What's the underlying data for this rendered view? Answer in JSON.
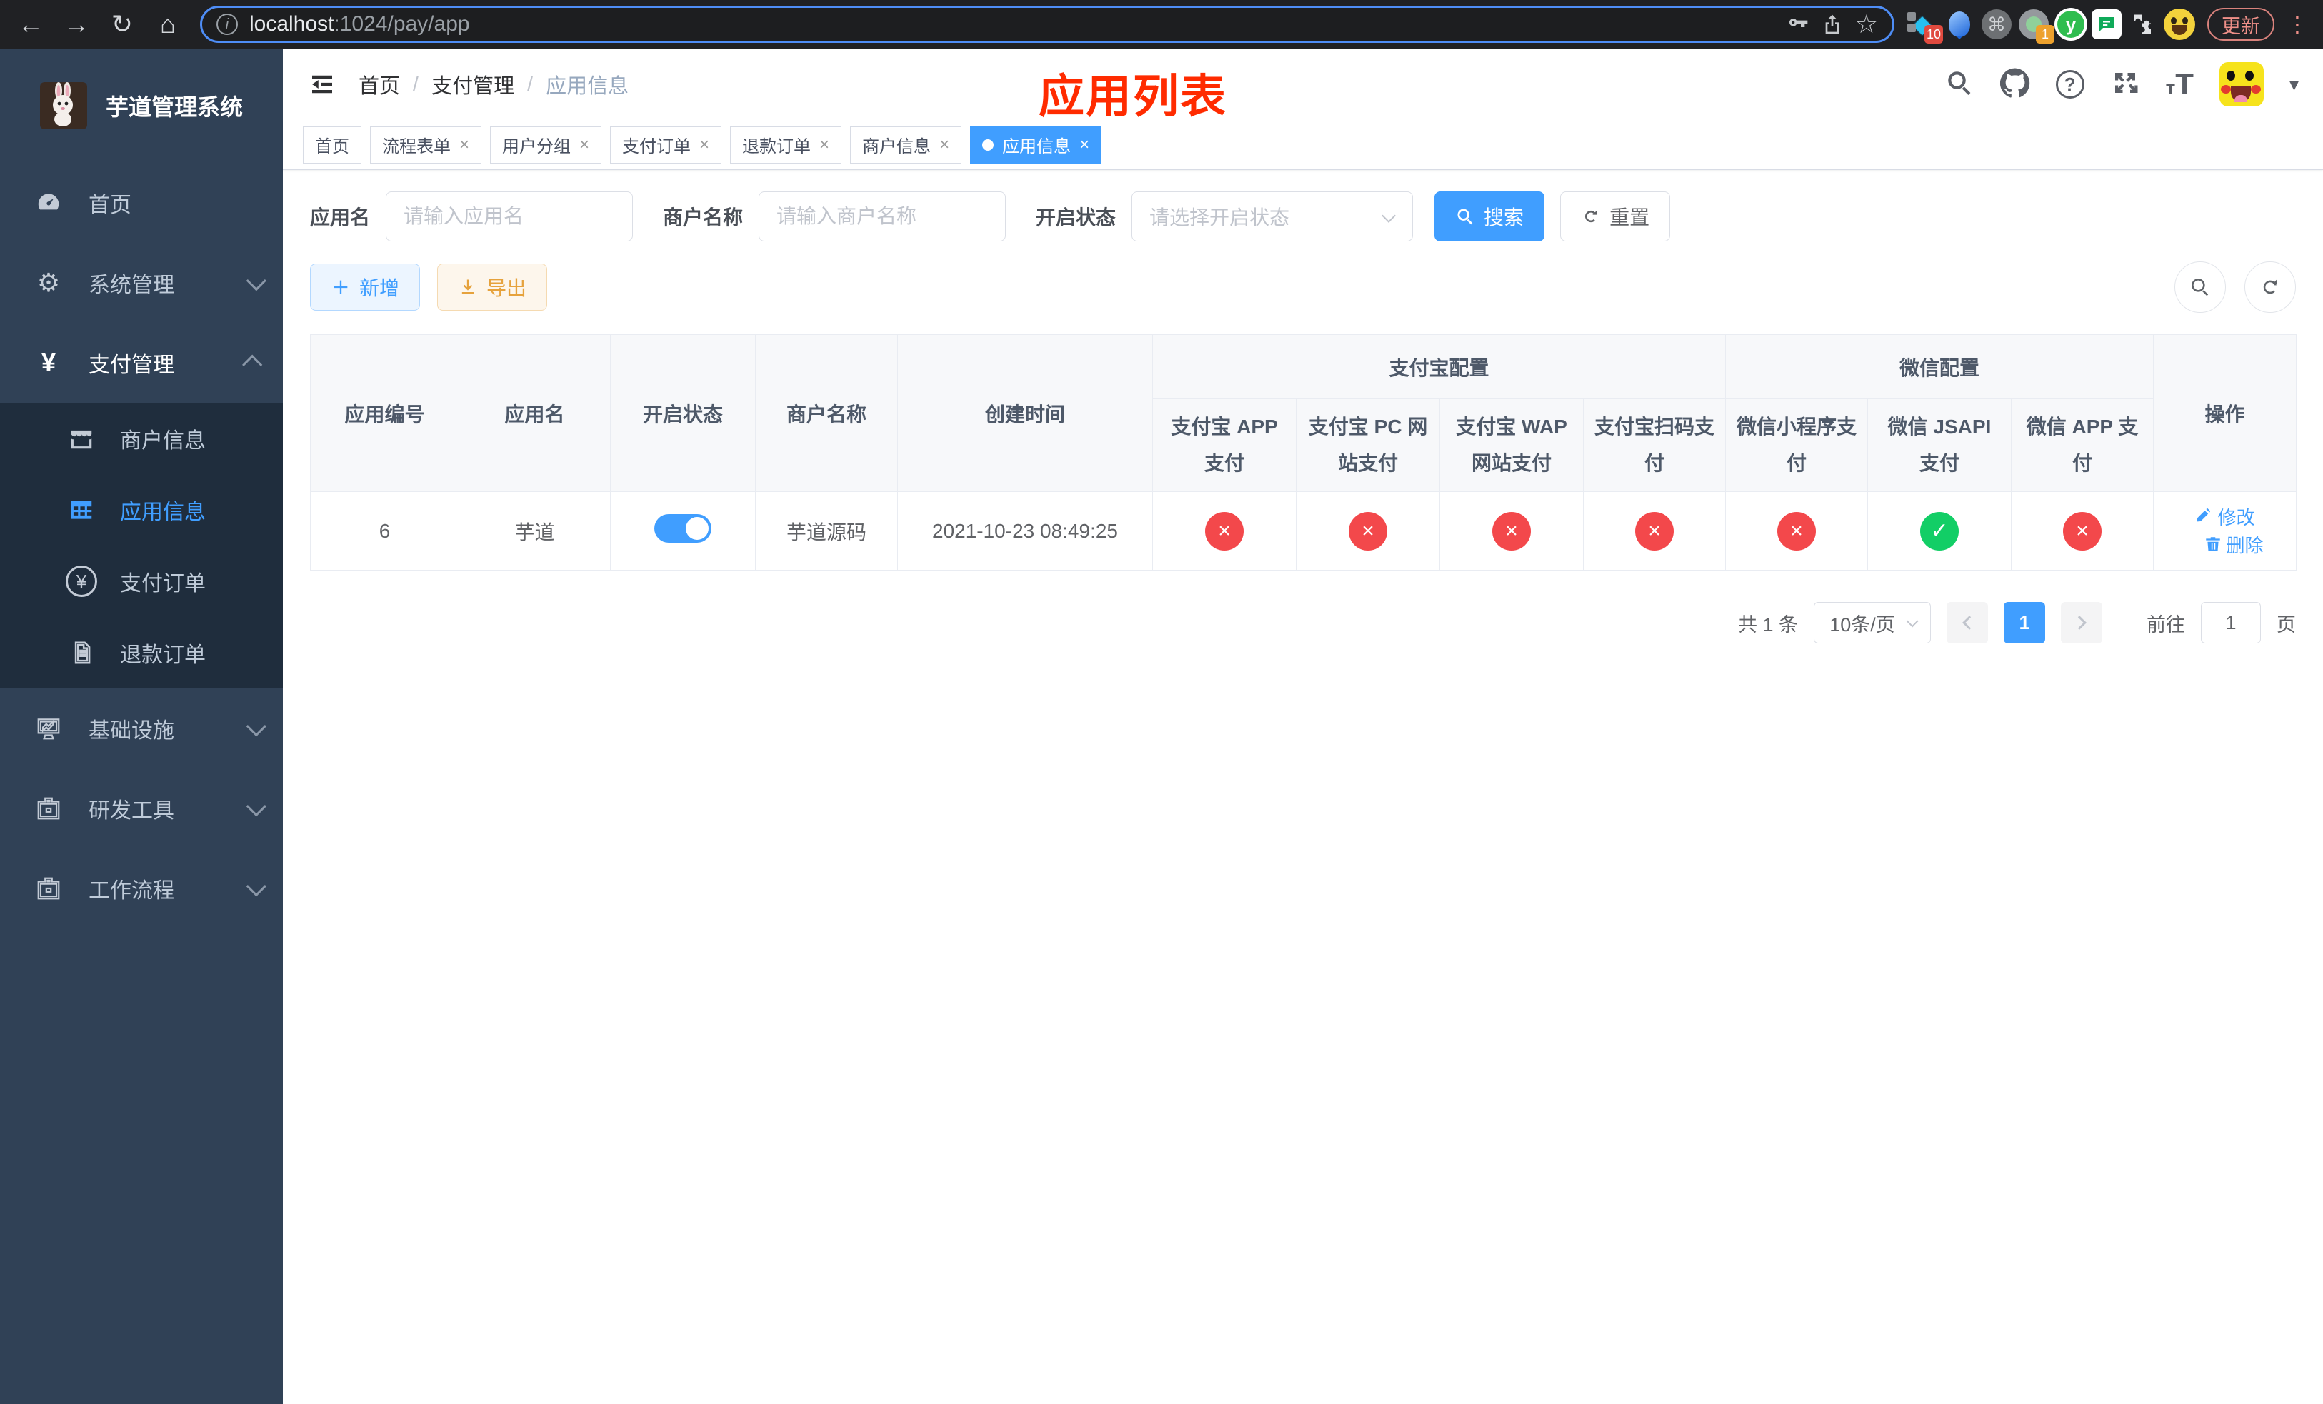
{
  "glyphs": {
    "back": "←",
    "forward": "→",
    "reload": "↻",
    "home": "⌂",
    "info": "i",
    "star": "☆",
    "diamond": "◆",
    "cmd": "⌘",
    "y": "y",
    "dots": "⋮",
    "slash": "/",
    "close": "×",
    "cross": "×",
    "check": "✓",
    "yen": "¥",
    "gear": "⚙",
    "caret": "▾",
    "question": "?",
    "t_small": "т",
    "t_big": "T"
  },
  "browser": {
    "url_host": "localhost",
    "url_path": ":1024/pay/app",
    "ext_badge_a": "10",
    "ext_badge_b": "1",
    "update_label": "更新"
  },
  "sidebar": {
    "title": "芋道管理系统",
    "home": "首页",
    "system": "系统管理",
    "pay": "支付管理",
    "merchant_info": "商户信息",
    "app_info": "应用信息",
    "pay_order": "支付订单",
    "refund_order": "退款订单",
    "infra": "基础设施",
    "dev_tools": "研发工具",
    "workflow": "工作流程"
  },
  "breadcrumb": {
    "home": "首页",
    "pay": "支付管理",
    "app": "应用信息"
  },
  "annotation": "应用列表",
  "tabs": [
    {
      "label": "首页"
    },
    {
      "label": "流程表单"
    },
    {
      "label": "用户分组"
    },
    {
      "label": "支付订单"
    },
    {
      "label": "退款订单"
    },
    {
      "label": "商户信息"
    },
    {
      "label": "应用信息"
    }
  ],
  "filters": {
    "app_name_label": "应用名",
    "app_name_placeholder": "请输入应用名",
    "merchant_label": "商户名称",
    "merchant_placeholder": "请输入商户名称",
    "status_label": "开启状态",
    "status_placeholder": "请选择开启状态",
    "search_label": "搜索",
    "reset_label": "重置"
  },
  "toolbar": {
    "add_label": "新增",
    "export_label": "导出"
  },
  "table": {
    "h_id": "应用编号",
    "h_name": "应用名",
    "h_status": "开启状态",
    "h_merchant": "商户名称",
    "h_created": "创建时间",
    "g_alipay": "支付宝配置",
    "g_wechat": "微信配置",
    "h_alipay_app": "支付宝 APP 支付",
    "h_alipay_pc": "支付宝 PC 网站支付",
    "h_alipay_wap": "支付宝 WAP 网站支付",
    "h_alipay_qr": "支付宝扫码支付",
    "h_wx_mini": "微信小程序支付",
    "h_wx_jsapi": "微信 JSAPI 支付",
    "h_wx_app": "微信 APP 支付",
    "h_op": "操作",
    "row": {
      "id": "6",
      "name": "芋道",
      "enabled": "on",
      "merchant": "芋道源码",
      "created": "2021-10-23 08:49:25",
      "alipay_app": "no",
      "alipay_pc": "no",
      "alipay_wap": "no",
      "alipay_qr": "no",
      "wx_mini": "no",
      "wx_jsapi": "yes",
      "wx_app": "no",
      "edit_label": "修改",
      "delete_label": "删除"
    }
  },
  "pagination": {
    "total": "共 1 条",
    "size": "10条/页",
    "page": "1",
    "goto_label": "前往",
    "goto_value": "1",
    "unit_label": "页"
  },
  "colors": {
    "accent": "#409eff",
    "sidebar_bg": "#304156",
    "submenu_bg": "#1f2d3d",
    "danger_circle": "#f3484b",
    "success_circle": "#12ce66",
    "annotation_red": "#ff2b00",
    "export_orange": "#e6a23c"
  }
}
